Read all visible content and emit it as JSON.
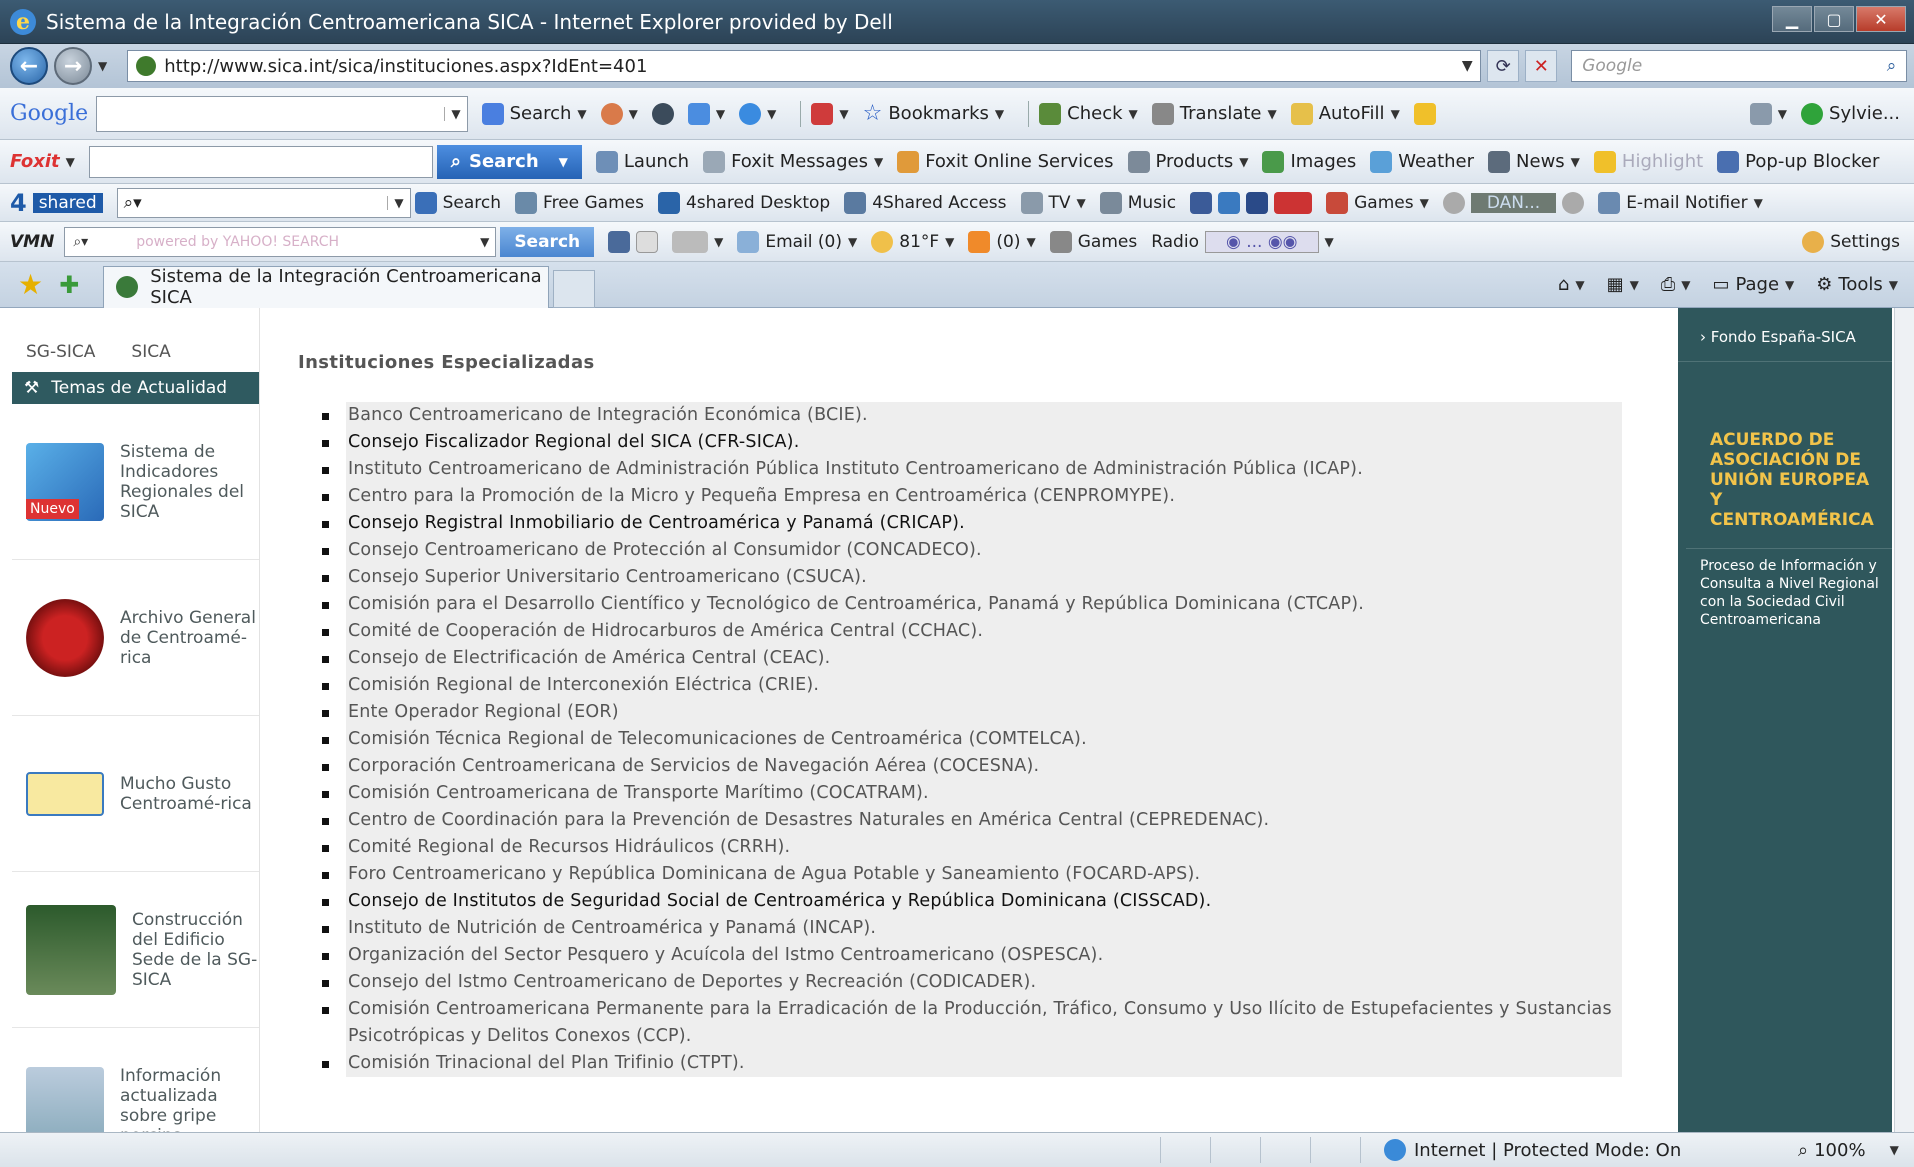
{
  "window": {
    "title": "Sistema de la Integración Centroamericana SICA - Internet Explorer provided by Dell"
  },
  "address": {
    "url": "http://www.sica.int/sica/instituciones.aspx?IdEnt=401",
    "search_placeholder": "Google"
  },
  "google_bar": {
    "logo": "Google",
    "search": "Search",
    "bookmarks": "Bookmarks",
    "check": "Check",
    "translate": "Translate",
    "autofill": "AutoFill",
    "user": "Sylvie..."
  },
  "foxit_bar": {
    "logo": "Foxit",
    "search": "Search",
    "launch": "Launch",
    "messages": "Foxit Messages",
    "online": "Foxit Online Services",
    "products": "Products",
    "images": "Images",
    "weather": "Weather",
    "news": "News",
    "highlight": "Highlight",
    "popup": "Pop-up Blocker"
  },
  "shared_bar": {
    "logo": "shared",
    "search": "Search",
    "free_games": "Free Games",
    "desktop": "4shared Desktop",
    "access": "4Shared Access",
    "tv": "TV",
    "music": "Music",
    "games": "Games",
    "player": "DAN...",
    "email_notifier": "E-mail Notifier"
  },
  "vmn_bar": {
    "logo": "VMN",
    "yahoo": "powered by YAHOO! SEARCH",
    "search": "Search",
    "email": "Email (0)",
    "temp": "81°F",
    "rss": "(0)",
    "games": "Games",
    "radio": "Radio",
    "settings": "Settings"
  },
  "tab": {
    "label": "Sistema de la Integración Centroamericana SICA"
  },
  "command_bar": {
    "page": "Page",
    "tools": "Tools"
  },
  "sidebar": {
    "top_left": "SG-SICA",
    "top_right": "SICA",
    "section_title": "Temas de Actualidad",
    "items": [
      {
        "label": "Sistema de Indicadores Regionales del SICA",
        "badge": "Nuevo"
      },
      {
        "label": "Archivo General de Centroamé-rica"
      },
      {
        "label": "Mucho Gusto Centroamé-rica"
      },
      {
        "label": "Construcción del Edificio Sede de la SG-SICA"
      },
      {
        "label": "Información actualizada sobre gripe porcina"
      }
    ]
  },
  "main": {
    "heading": "Instituciones Especializadas",
    "institutions": [
      "Banco Centroamericano de Integración Económica (BCIE).",
      "Consejo Fiscalizador Regional del SICA (CFR-SICA).",
      "Instituto Centroamericano de Administración Pública Instituto Centroamericano de Administración Pública (ICAP).",
      "Centro para la Promoción de la Micro y Pequeña Empresa en Centroamérica (CENPROMYPE).",
      "Consejo Registral Inmobiliario de Centroamérica y Panamá (CRICAP).",
      "Consejo Centroamericano de Protección al Consumidor (CONCADECO).",
      "Consejo Superior Universitario Centroamericano (CSUCA).",
      "Comisión para el Desarrollo Científico y Tecnológico de Centroamérica, Panamá y República Dominicana (CTCAP).",
      "Comité de Cooperación de Hidrocarburos de América Central (CCHAC).",
      "Consejo de Electrificación de América Central (CEAC).",
      "Comisión Regional de Interconexión Eléctrica (CRIE).",
      "Ente Operador Regional (EOR)",
      "Comisión Técnica Regional de Telecomunicaciones de Centroamérica (COMTELCA).",
      "Corporación Centroamericana de Servicios de Navegación Aérea (COCESNA).",
      "Comisión Centroamericana de Transporte Marítimo (COCATRAM).",
      "Centro de Coordinación para la Prevención de Desastres Naturales en América Central (CEPREDENAC).",
      "Comité Regional de Recursos Hidráulicos (CRRH).",
      "Foro Centroamericano y República Dominicana de Agua Potable y Saneamiento (FOCARD-APS).",
      "Consejo de Institutos de Seguridad Social de Centroamérica y República Dominicana (CISSCAD).",
      "Instituto de Nutrición de Centroamérica y Panamá (INCAP).",
      "Organización del Sector Pesquero y Acuícola del Istmo Centroamericano (OSPESCA).",
      "Consejo del Istmo Centroamericano de Deportes y Recreación (CODICADER).",
      "Comisión Centroamericana Permanente para la Erradicación de la Producción, Tráfico, Consumo y Uso Ilícito de Estupefacientes y Sustancias Psicotrópicas y Delitos Conexos (CCP).",
      "Comisión Trinacional del Plan Trifinio (CTPT)."
    ]
  },
  "rightbar": {
    "link": "Fondo España-SICA",
    "heading": "ACUERDO DE ASOCIACIÓN DE UNIÓN EUROPEA Y CENTROAMÉRICA",
    "sub": "Proceso de Información y Consulta a Nivel Regional con la Sociedad Civil Centroamericana"
  },
  "status": {
    "zone": "Internet | Protected Mode: On",
    "zoom": "100%"
  }
}
